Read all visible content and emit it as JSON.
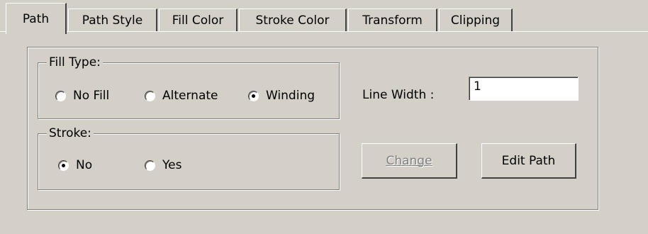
{
  "tabs": [
    {
      "label": "Path",
      "active": true
    },
    {
      "label": "Path Style",
      "active": false
    },
    {
      "label": "Fill Color",
      "active": false
    },
    {
      "label": "Stroke Color",
      "active": false
    },
    {
      "label": "Transform",
      "active": false
    },
    {
      "label": "Clipping",
      "active": false
    }
  ],
  "fill_type": {
    "legend": "Fill Type:",
    "options": [
      {
        "label": "No Fill",
        "checked": false
      },
      {
        "label": "Alternate",
        "checked": false
      },
      {
        "label": "Winding",
        "checked": true
      }
    ]
  },
  "stroke": {
    "legend": "Stroke:",
    "options": [
      {
        "label": "No",
        "checked": true
      },
      {
        "label": "Yes",
        "checked": false
      }
    ]
  },
  "line_width": {
    "label": "Line Width :",
    "value": "1"
  },
  "buttons": {
    "change": {
      "label": "Change",
      "enabled": false
    },
    "edit_path": {
      "label": "Edit Path",
      "enabled": true
    }
  }
}
